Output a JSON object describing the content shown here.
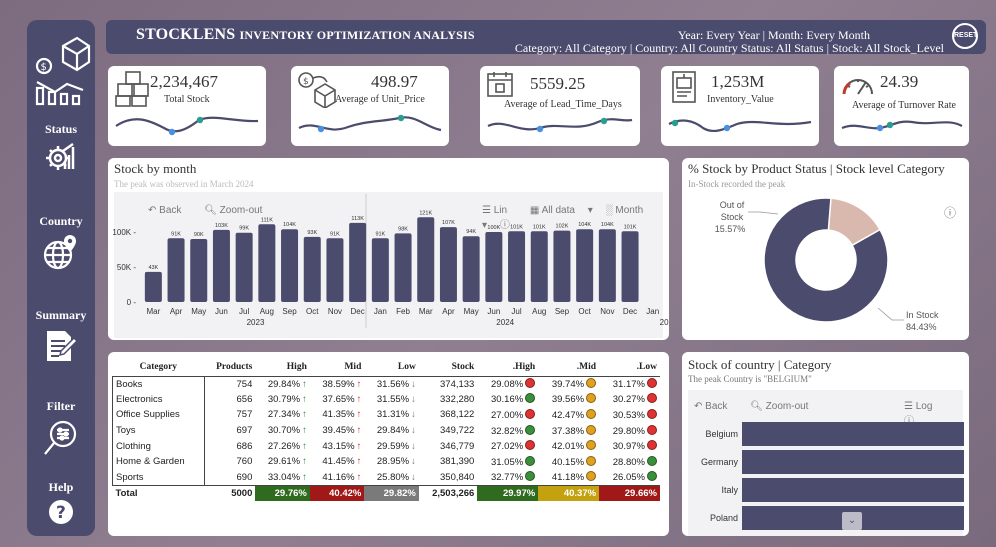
{
  "header": {
    "title_big": "STOCKLENS",
    "title_rest": "INVENTORY OPTIMIZATION ANALYSIS",
    "filters_line1": "Year: Every Year | Month: Every Month",
    "filters_line2": "Category: All Category | Country: All Country Status: All Status | Stock: All Stock_Level",
    "reset_label": "RESET"
  },
  "sidebar": {
    "items": [
      {
        "label": "Status",
        "icon": "status-gear-chart-icon"
      },
      {
        "label": "Country",
        "icon": "globe-pin-icon"
      },
      {
        "label": "Summary",
        "icon": "report-edit-icon"
      },
      {
        "label": "Filter",
        "icon": "filter-search-icon"
      },
      {
        "label": "Help",
        "icon": "question-icon"
      }
    ]
  },
  "kpis": [
    {
      "value": "2,234,467",
      "caption": "Total Stock",
      "icon": "boxes-icon"
    },
    {
      "value": "498.97",
      "caption": "Average of Unit_Price",
      "icon": "price-box-icon"
    },
    {
      "value": "5559.25",
      "caption": "Average of Lead_Time_Days",
      "icon": "calendar-box-icon"
    },
    {
      "value": "1,253M",
      "caption": "Inventory_Value",
      "icon": "inventory-icon"
    },
    {
      "value": "24.39",
      "caption": "Average of Turnover Rate",
      "icon": "gauge-icon"
    }
  ],
  "colors": {
    "navy": "#4b4b6e",
    "teal": "#2a9d8f",
    "blue": "#4a90e2",
    "rose": "#d9b8ad",
    "green_cell": "#2e6b1f",
    "red_cell": "#a01818",
    "grey_cell": "#7a7a7a",
    "gold_cell": "#c4a10f"
  },
  "stock_chart": {
    "title": "Stock by month",
    "subtitle": "The peak was observed in March 2024",
    "toolbar": {
      "back": "Back",
      "zoom": "Zoom-out",
      "lin": "Lin",
      "alldata": "All data",
      "month": "Month"
    }
  },
  "chart_data": [
    {
      "type": "bar",
      "categories": [
        "Mar",
        "Apr",
        "May",
        "Jun",
        "Jul",
        "Aug",
        "Sep",
        "Oct",
        "Nov",
        "Dec",
        "Jan",
        "Feb",
        "Mar",
        "Apr",
        "May",
        "Jun",
        "Jul",
        "Aug",
        "Sep",
        "Oct",
        "Nov",
        "Dec",
        "Jan"
      ],
      "year_groups": [
        {
          "label": "2023",
          "span": 10
        },
        {
          "label": "2024",
          "span": 12
        },
        {
          "label": "20",
          "span": 1
        }
      ],
      "values": [
        43,
        91,
        90,
        103,
        99,
        111,
        104,
        93,
        91,
        113,
        91,
        98,
        121,
        107,
        94,
        100,
        101,
        101,
        102,
        104,
        104,
        101,
        null
      ],
      "labels": [
        "43K",
        "91K",
        "90K",
        "103K",
        "99K",
        "111K",
        "104K",
        "93K",
        "91K",
        "113K",
        "91K",
        "98K",
        "121K",
        "107K",
        "94K",
        "100K",
        "101K",
        "101K",
        "102K",
        "104K",
        "104K",
        "101K",
        ""
      ],
      "y_ticks": [
        "0",
        "50K",
        "100K"
      ],
      "ylim": [
        0,
        125
      ]
    },
    {
      "type": "pie",
      "title": "% Stock by Product Status | Stock level Category",
      "subtitle": "In-Stock recorded the peak",
      "slices": [
        {
          "name": "Out of Stock",
          "value": 15.57,
          "label_name": "Out of Stock",
          "label_pct": "15.57%"
        },
        {
          "name": "In Stock",
          "value": 84.43,
          "label_name": "In Stock",
          "label_pct": "84.43%"
        }
      ]
    },
    {
      "type": "bar",
      "title": "Stock of country | Category",
      "subtitle": "The peak Country is \"BELGIUM\"",
      "categories": [
        "Belgium",
        "Germany",
        "Italy",
        "Poland"
      ],
      "toolbar": {
        "back": "Back",
        "zoom": "Zoom-out",
        "log": "Log"
      }
    }
  ],
  "table": {
    "headers": [
      "Category",
      "Products",
      "High",
      "Mid",
      "Low",
      "Stock",
      ".High",
      ".Mid",
      ".Low"
    ],
    "rows": [
      {
        "cat": "Books",
        "products": "754",
        "high": "29.84%",
        "mid": "38.59%",
        "low": "31.56%",
        "stock": "374,133",
        "h2": "29.08%",
        "m2": "39.74%",
        "l2": "31.17%"
      },
      {
        "cat": "Electronics",
        "products": "656",
        "high": "30.79%",
        "mid": "37.65%",
        "low": "31.55%",
        "stock": "332,280",
        "h2": "30.16%",
        "m2": "39.56%",
        "l2": "30.27%"
      },
      {
        "cat": "Office Supplies",
        "products": "757",
        "high": "27.34%",
        "mid": "41.35%",
        "low": "31.31%",
        "stock": "368,122",
        "h2": "27.00%",
        "m2": "42.47%",
        "l2": "30.53%"
      },
      {
        "cat": "Toys",
        "products": "697",
        "high": "30.70%",
        "mid": "39.45%",
        "low": "29.84%",
        "stock": "349,722",
        "h2": "32.82%",
        "m2": "37.38%",
        "l2": "29.80%"
      },
      {
        "cat": "Clothing",
        "products": "686",
        "high": "27.26%",
        "mid": "43.15%",
        "low": "29.59%",
        "stock": "346,779",
        "h2": "27.02%",
        "m2": "42.01%",
        "l2": "30.97%"
      },
      {
        "cat": "Home & Garden",
        "products": "760",
        "high": "29.61%",
        "mid": "41.45%",
        "low": "28.95%",
        "stock": "381,390",
        "h2": "31.05%",
        "m2": "40.15%",
        "l2": "28.80%"
      },
      {
        "cat": "Sports",
        "products": "690",
        "high": "33.04%",
        "mid": "41.16%",
        "low": "25.80%",
        "stock": "350,840",
        "h2": "32.77%",
        "m2": "41.18%",
        "l2": "26.05%"
      }
    ],
    "total": {
      "cat": "Total",
      "products": "5000",
      "high": "29.76%",
      "mid": "40.42%",
      "low": "29.82%",
      "stock": "2,503,266",
      "h2": "29.97%",
      "m2": "40.37%",
      "l2": "29.66%"
    }
  }
}
